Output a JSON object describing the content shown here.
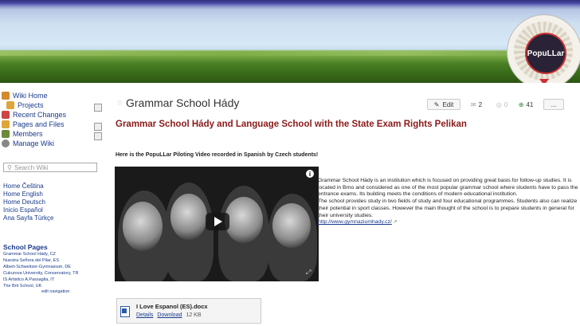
{
  "banner": {
    "logo_text": "PopuLLar"
  },
  "nav": {
    "items": [
      {
        "label": "Wiki Home",
        "icon": "home-icon",
        "color": "#d28a2a"
      },
      {
        "label": "Projects",
        "icon": "projects-icon",
        "color": "#e0a53a"
      },
      {
        "label": "Recent Changes",
        "icon": "calendar-icon",
        "color": "#c44"
      },
      {
        "label": "Pages and Files",
        "icon": "folder-icon",
        "color": "#e0a53a"
      },
      {
        "label": "Members",
        "icon": "members-icon",
        "color": "#6a8a3a"
      },
      {
        "label": "Manage Wiki",
        "icon": "gear-icon",
        "color": "#888"
      }
    ],
    "search_placeholder": "Search Wiki",
    "language_links": [
      "Home Čeština",
      "Home English",
      "Home Deutsch",
      "Inicio Español",
      "Ana Sayfa Türkçe"
    ],
    "school_pages_title": "School Pages",
    "school_pages": [
      "Grammar School Hády, CZ",
      "Nuestra Señora del Pilar, ES",
      "Albert-Schweitzer-Gymnasium, DE",
      "Cukurova University, Conservatory, TR",
      "IS Artistico A.Passaglia, IT",
      "The Brit School, UK"
    ],
    "edit_navigation": "edit navigation"
  },
  "main": {
    "page_title": "Grammar School Hády",
    "toolbar": {
      "edit": "Edit",
      "count_a": "2",
      "count_b": "0",
      "count_c": "41",
      "more": "..."
    },
    "headline": "Grammar School Hády and Language School with the State Exam Rights Pelikan",
    "subhead": "Here is the PopuLLar Piloting Video recorded in Spanish by Czech students!",
    "description_1": "Grammar School Hády is an institution which is focused on providing great basis for follow-up studies. It is located in Brno and considered as one of the most popular grammar school where students have to pass the entrance exams. Its building meets the conditions of modern educational institution.",
    "description_2": "The school provides study in two fields of study and four educational programmes. Students also can realize their potential in sport classes. However the main thought of the school is to prepare students in general for their university studies.",
    "link": "http://www.gymnaziumhady.cz/",
    "attachment": {
      "name": "I Love Espanol (ES).docx",
      "details": "Details",
      "download": "Download",
      "size": "12 KB"
    }
  }
}
